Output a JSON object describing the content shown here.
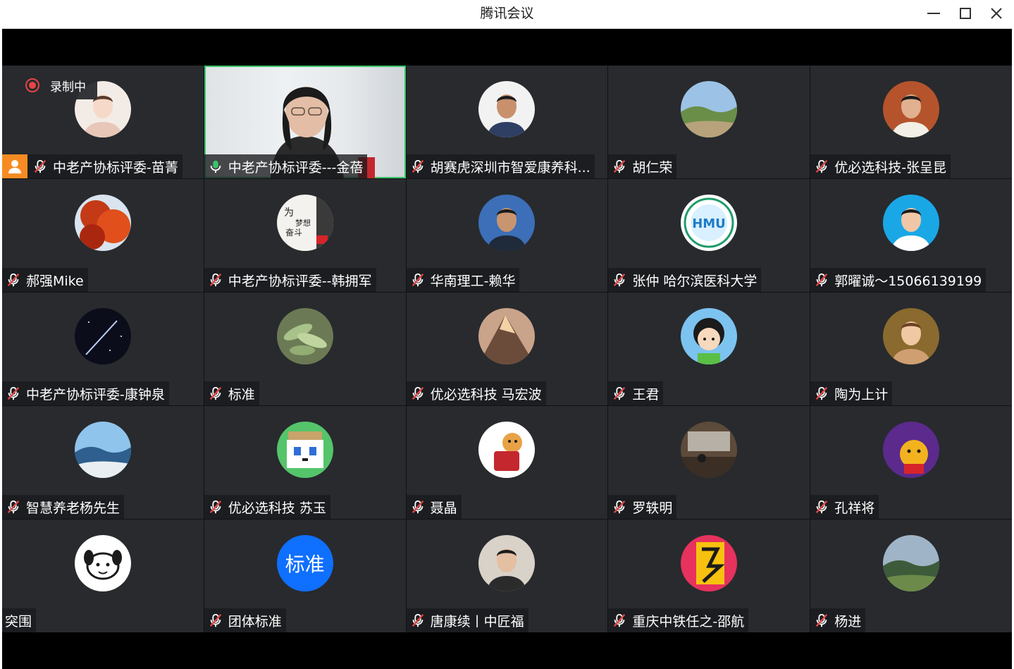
{
  "window": {
    "title": "腾讯会议"
  },
  "recording": {
    "label": "录制中"
  },
  "participants": [
    {
      "name": "中老产协标评委-苗菁",
      "avatar": "woman-illustration",
      "host": true,
      "mic": "muted"
    },
    {
      "name": "中老产协标评委---金蓓",
      "avatar": "video",
      "mic": "speaking"
    },
    {
      "name": "胡赛虎深圳市智爱康养科...",
      "avatar": "man-portrait",
      "mic": "muted"
    },
    {
      "name": "胡仁荣",
      "avatar": "landscape-path",
      "mic": "muted"
    },
    {
      "name": "优必选科技-张呈昆",
      "avatar": "man-indoor",
      "mic": "muted"
    },
    {
      "name": "郝强Mike",
      "avatar": "red-leaves",
      "mic": "muted"
    },
    {
      "name": "中老产协标评委--韩拥军",
      "avatar": "calligraphy",
      "mic": "muted"
    },
    {
      "name": "华南理工-赖华",
      "avatar": "man-snow",
      "mic": "muted"
    },
    {
      "name": "张仲 哈尔滨医科大学",
      "avatar": "university-logo",
      "mic": "muted"
    },
    {
      "name": "郭曜诚～15066139199",
      "avatar": "man-blue-bg",
      "mic": "muted"
    },
    {
      "name": "中老产协标评委-康钟泉",
      "avatar": "night-sky",
      "mic": "muted"
    },
    {
      "name": "标准",
      "avatar": "succulent",
      "mic": "muted"
    },
    {
      "name": "优必选科技 马宏波",
      "avatar": "mountain-peak",
      "mic": "muted"
    },
    {
      "name": "王君",
      "avatar": "cartoon-boy",
      "mic": "muted"
    },
    {
      "name": "陶为上计",
      "avatar": "girl-bokeh",
      "mic": "muted"
    },
    {
      "name": "智慧养老杨先生",
      "avatar": "sea-waves",
      "mic": "muted"
    },
    {
      "name": "优必选科技 苏玉",
      "avatar": "pixel-cat",
      "mic": "muted"
    },
    {
      "name": "聂晶",
      "avatar": "cat-box",
      "mic": "muted"
    },
    {
      "name": "罗轶明",
      "avatar": "room-interior",
      "mic": "muted"
    },
    {
      "name": "孔祥将",
      "avatar": "tiger-newyear",
      "mic": "muted"
    },
    {
      "name": "突围",
      "avatar": "doodle-dog",
      "mic": "none"
    },
    {
      "name": "团体标准",
      "avatar": "text",
      "avatar_text": "标准",
      "mic": "muted"
    },
    {
      "name": "唐康续丨中匠福",
      "avatar": "man-bowtie",
      "mic": "muted"
    },
    {
      "name": "重庆中铁任之-邵航",
      "avatar": "year-poster",
      "mic": "muted"
    },
    {
      "name": "杨进",
      "avatar": "golf-landscape",
      "mic": "muted"
    }
  ],
  "colors": {
    "accent_speaking": "#38c46a",
    "host_badge": "#f78b22",
    "tile_bg": "#282a2e",
    "muted_red": "#e54545"
  }
}
